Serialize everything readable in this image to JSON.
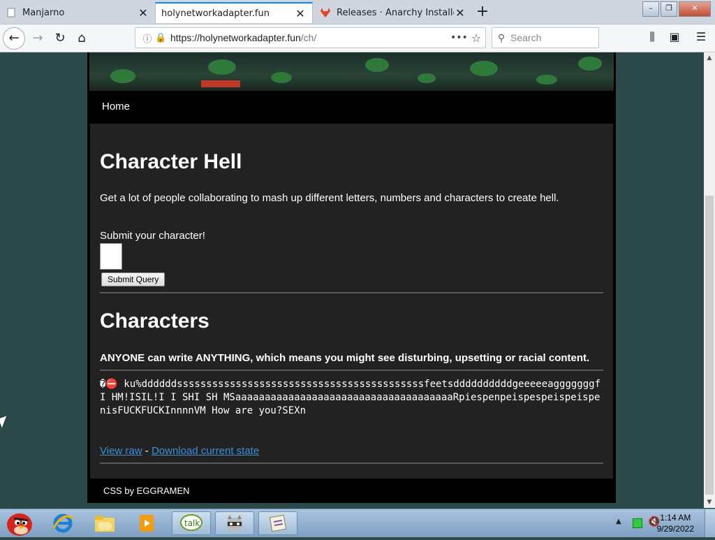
{
  "browser": {
    "tabs": [
      {
        "label": "Manjarno",
        "active": false
      },
      {
        "label": "holynetworkadapter.fun",
        "active": true
      },
      {
        "label": "Releases · Anarchy Installer / i",
        "active": false
      }
    ],
    "url": {
      "host": "https://holynetworkadapter.fun",
      "path": "/ch/"
    },
    "search_placeholder": "Search"
  },
  "site": {
    "nav_home": "Home",
    "title": "Character Hell",
    "intro": "Get a lot of people collaborating to mash up different letters, numbers and characters to create hell.",
    "form_label": "Submit your character!",
    "submit_label": "Submit Query",
    "characters_heading": "Characters",
    "warning": "ANYONE can write ANYTHING, which means you might see disturbing, upsetting or racial content.",
    "characters_text": "�⛔ ku%ddddddssssssssssssssssssssssssssssssssssssssssssfeetsddddddddddgeeeeeagggggggfI HM!ISIL!I I SHI SH MSaaaaaaaaaaaaaaaaaaaaaaaaaaaaaaaaaaaaaRpiespenpeispespeispeispenisFUCKFUCKInnnnVM How are you?SEXn",
    "link_raw": "View raw",
    "link_sep": " - ",
    "link_download": "Download current state",
    "footer": "CSS by EGGRAMEN"
  },
  "taskbar": {
    "time": "1:14 AM",
    "date": "9/29/2022",
    "apps": [
      "angry-birds-start",
      "internet-explorer",
      "file-explorer",
      "media-player",
      "talk",
      "raccoon-app",
      "notepad-app"
    ]
  }
}
